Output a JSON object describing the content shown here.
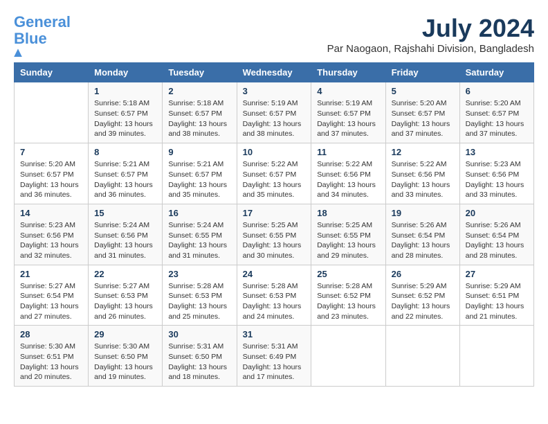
{
  "logo": {
    "line1": "General",
    "line2": "Blue"
  },
  "title": "July 2024",
  "location": "Par Naogaon, Rajshahi Division, Bangladesh",
  "weekdays": [
    "Sunday",
    "Monday",
    "Tuesday",
    "Wednesday",
    "Thursday",
    "Friday",
    "Saturday"
  ],
  "weeks": [
    [
      {
        "day": "",
        "info": ""
      },
      {
        "day": "1",
        "info": "Sunrise: 5:18 AM\nSunset: 6:57 PM\nDaylight: 13 hours\nand 39 minutes."
      },
      {
        "day": "2",
        "info": "Sunrise: 5:18 AM\nSunset: 6:57 PM\nDaylight: 13 hours\nand 38 minutes."
      },
      {
        "day": "3",
        "info": "Sunrise: 5:19 AM\nSunset: 6:57 PM\nDaylight: 13 hours\nand 38 minutes."
      },
      {
        "day": "4",
        "info": "Sunrise: 5:19 AM\nSunset: 6:57 PM\nDaylight: 13 hours\nand 37 minutes."
      },
      {
        "day": "5",
        "info": "Sunrise: 5:20 AM\nSunset: 6:57 PM\nDaylight: 13 hours\nand 37 minutes."
      },
      {
        "day": "6",
        "info": "Sunrise: 5:20 AM\nSunset: 6:57 PM\nDaylight: 13 hours\nand 37 minutes."
      }
    ],
    [
      {
        "day": "7",
        "info": "Sunrise: 5:20 AM\nSunset: 6:57 PM\nDaylight: 13 hours\nand 36 minutes."
      },
      {
        "day": "8",
        "info": "Sunrise: 5:21 AM\nSunset: 6:57 PM\nDaylight: 13 hours\nand 36 minutes."
      },
      {
        "day": "9",
        "info": "Sunrise: 5:21 AM\nSunset: 6:57 PM\nDaylight: 13 hours\nand 35 minutes."
      },
      {
        "day": "10",
        "info": "Sunrise: 5:22 AM\nSunset: 6:57 PM\nDaylight: 13 hours\nand 35 minutes."
      },
      {
        "day": "11",
        "info": "Sunrise: 5:22 AM\nSunset: 6:56 PM\nDaylight: 13 hours\nand 34 minutes."
      },
      {
        "day": "12",
        "info": "Sunrise: 5:22 AM\nSunset: 6:56 PM\nDaylight: 13 hours\nand 33 minutes."
      },
      {
        "day": "13",
        "info": "Sunrise: 5:23 AM\nSunset: 6:56 PM\nDaylight: 13 hours\nand 33 minutes."
      }
    ],
    [
      {
        "day": "14",
        "info": "Sunrise: 5:23 AM\nSunset: 6:56 PM\nDaylight: 13 hours\nand 32 minutes."
      },
      {
        "day": "15",
        "info": "Sunrise: 5:24 AM\nSunset: 6:56 PM\nDaylight: 13 hours\nand 31 minutes."
      },
      {
        "day": "16",
        "info": "Sunrise: 5:24 AM\nSunset: 6:55 PM\nDaylight: 13 hours\nand 31 minutes."
      },
      {
        "day": "17",
        "info": "Sunrise: 5:25 AM\nSunset: 6:55 PM\nDaylight: 13 hours\nand 30 minutes."
      },
      {
        "day": "18",
        "info": "Sunrise: 5:25 AM\nSunset: 6:55 PM\nDaylight: 13 hours\nand 29 minutes."
      },
      {
        "day": "19",
        "info": "Sunrise: 5:26 AM\nSunset: 6:54 PM\nDaylight: 13 hours\nand 28 minutes."
      },
      {
        "day": "20",
        "info": "Sunrise: 5:26 AM\nSunset: 6:54 PM\nDaylight: 13 hours\nand 28 minutes."
      }
    ],
    [
      {
        "day": "21",
        "info": "Sunrise: 5:27 AM\nSunset: 6:54 PM\nDaylight: 13 hours\nand 27 minutes."
      },
      {
        "day": "22",
        "info": "Sunrise: 5:27 AM\nSunset: 6:53 PM\nDaylight: 13 hours\nand 26 minutes."
      },
      {
        "day": "23",
        "info": "Sunrise: 5:28 AM\nSunset: 6:53 PM\nDaylight: 13 hours\nand 25 minutes."
      },
      {
        "day": "24",
        "info": "Sunrise: 5:28 AM\nSunset: 6:53 PM\nDaylight: 13 hours\nand 24 minutes."
      },
      {
        "day": "25",
        "info": "Sunrise: 5:28 AM\nSunset: 6:52 PM\nDaylight: 13 hours\nand 23 minutes."
      },
      {
        "day": "26",
        "info": "Sunrise: 5:29 AM\nSunset: 6:52 PM\nDaylight: 13 hours\nand 22 minutes."
      },
      {
        "day": "27",
        "info": "Sunrise: 5:29 AM\nSunset: 6:51 PM\nDaylight: 13 hours\nand 21 minutes."
      }
    ],
    [
      {
        "day": "28",
        "info": "Sunrise: 5:30 AM\nSunset: 6:51 PM\nDaylight: 13 hours\nand 20 minutes."
      },
      {
        "day": "29",
        "info": "Sunrise: 5:30 AM\nSunset: 6:50 PM\nDaylight: 13 hours\nand 19 minutes."
      },
      {
        "day": "30",
        "info": "Sunrise: 5:31 AM\nSunset: 6:50 PM\nDaylight: 13 hours\nand 18 minutes."
      },
      {
        "day": "31",
        "info": "Sunrise: 5:31 AM\nSunset: 6:49 PM\nDaylight: 13 hours\nand 17 minutes."
      },
      {
        "day": "",
        "info": ""
      },
      {
        "day": "",
        "info": ""
      },
      {
        "day": "",
        "info": ""
      }
    ]
  ]
}
